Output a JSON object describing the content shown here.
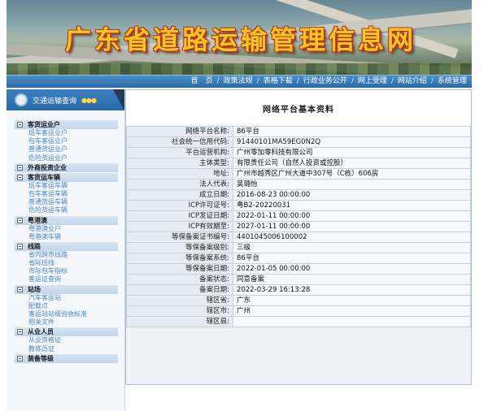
{
  "banner": {
    "title": "广东省道路运输管理信息网"
  },
  "nav": {
    "items": [
      {
        "label": "首　页"
      },
      {
        "label": "政策法规"
      },
      {
        "label": "表格下载"
      },
      {
        "label": "行政业务公开"
      },
      {
        "label": "网上受理"
      },
      {
        "label": "网站介绍"
      },
      {
        "label": "系统管理"
      }
    ],
    "separator": "/"
  },
  "sidebar": {
    "title": "交通运输查询",
    "dots": "●●●",
    "categories": [
      {
        "label": "客货运业户",
        "items": [
          "班车客运业户",
          "包车客运业户",
          "普通货运业户",
          "危险货运业户"
        ]
      },
      {
        "label": "外商投资企业",
        "items": []
      },
      {
        "label": "客货运车辆",
        "items": [
          "班车客运车辆",
          "包车客运车辆",
          "普通货运车辆",
          "危险货运车辆"
        ]
      },
      {
        "label": "粤港澳",
        "items": [
          "粤港澳业户",
          "粤港澳车辆"
        ]
      },
      {
        "label": "线路",
        "items": [
          "省内跨市线路",
          "省际班线",
          "市际包车指标",
          "客运证查询"
        ]
      },
      {
        "label": "站场",
        "items": [
          "汽车客运站",
          "配载点",
          "客运站站级验收标准",
          "相关文件"
        ]
      },
      {
        "label": "从业人员",
        "items": [
          "从业资格证",
          "教练员证"
        ]
      },
      {
        "label": "装备等级",
        "items": []
      }
    ]
  },
  "content": {
    "title": "网络平台基本资料",
    "rows": [
      {
        "key": "网络平台名称:",
        "value": "86平台"
      },
      {
        "key": "社会统一信用代码:",
        "value": "91440101MA59EG0N2Q"
      },
      {
        "key": "平台运营机构:",
        "value": "广州零加零科技有限公司"
      },
      {
        "key": "主体类型:",
        "value": "有限责任公司（自然人投资或控股）"
      },
      {
        "key": "地址:",
        "value": "广州市越秀区广州大道中307号（C栋）606房"
      },
      {
        "key": "法人代表:",
        "value": "吴璐怡"
      },
      {
        "key": "成立日期:",
        "value": "2016-08-23 00:00:00"
      },
      {
        "key": "ICP许可证号:",
        "value": "粤B2-20220031"
      },
      {
        "key": "ICP发证日期:",
        "value": "2022-01-11 00:00:00"
      },
      {
        "key": "ICP有效期至:",
        "value": "2027-01-11 00:00:00"
      },
      {
        "key": "等保备案证书编号:",
        "value": "4401045006100002"
      },
      {
        "key": "等保备案级别:",
        "value": "三级"
      },
      {
        "key": "等保备案系统:",
        "value": "86平台"
      },
      {
        "key": "等保备案日期:",
        "value": "2022-01-05 00:00:00"
      },
      {
        "key": "备案状态:",
        "value": "同意备案"
      },
      {
        "key": "备案日期:",
        "value": "2022-03-29 16:13:28"
      },
      {
        "key": "辖区省:",
        "value": "广东"
      },
      {
        "key": "辖区市:",
        "value": "广州"
      },
      {
        "key": "辖区县:",
        "value": ""
      }
    ]
  },
  "colors": {
    "nav": "#2b6aa8",
    "title_fill": "#f3c623",
    "title_outline": "#b5361f",
    "link": "#4d87c1"
  }
}
